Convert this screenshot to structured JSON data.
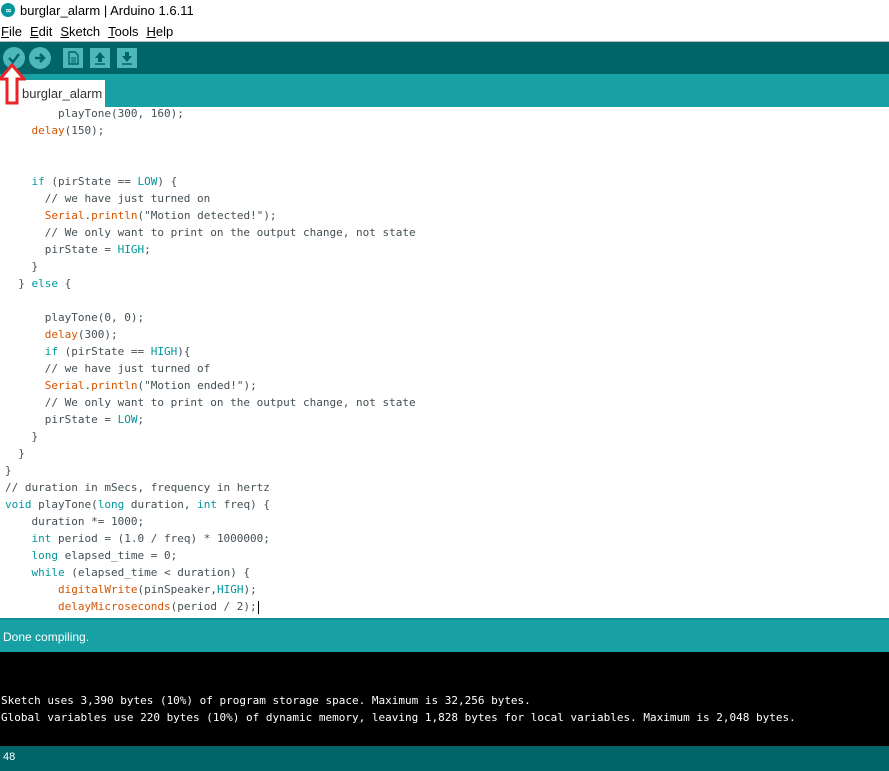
{
  "window": {
    "title": "burglar_alarm | Arduino 1.6.11",
    "logo_icon": "arduino-logo-icon"
  },
  "menu": [
    {
      "first": "F",
      "rest": "ile"
    },
    {
      "first": "E",
      "rest": "dit"
    },
    {
      "first": "S",
      "rest": "ketch"
    },
    {
      "first": "T",
      "rest": "ools"
    },
    {
      "first": "H",
      "rest": "elp"
    }
  ],
  "toolbar": {
    "buttons": [
      "verify-icon",
      "upload-icon",
      "new-icon",
      "open-icon",
      "save-icon"
    ]
  },
  "tab": {
    "label": "burglar_alarm"
  },
  "code": [
    "    playTone(300, 160);",
    "    delay(150);",
    "",
    "",
    "    if (pirState == LOW) {",
    "      // we have just turned on",
    "      Serial.println(\"Motion detected!\");",
    "      // We only want to print on the output change, not state",
    "      pirState = HIGH;",
    "    }",
    "  } else {",
    "",
    "      playTone(0, 0);",
    "      delay(300);",
    "      if (pirState == HIGH){",
    "      // we have just turned of",
    "      Serial.println(\"Motion ended!\");",
    "      // We only want to print on the output change, not state",
    "      pirState = LOW;",
    "    }",
    "  }",
    "}",
    "// duration in mSecs, frequency in hertz",
    "void playTone(long duration, int freq) {",
    "    duration *= 1000;",
    "    int period = (1.0 / freq) * 1000000;",
    "    long elapsed_time = 0;",
    "    while (elapsed_time < duration) {",
    "        digitalWrite(pinSpeaker,HIGH);",
    "        delayMicroseconds(period / 2);"
  ],
  "status": {
    "message": "Done compiling."
  },
  "console": {
    "lines": [
      "Sketch uses 3,390 bytes (10%) of program storage space. Maximum is 32,256 bytes.",
      "Global variables use 220 bytes (10%) of dynamic memory, leaving 1,828 bytes for local variables. Maximum is 2,048 bytes."
    ]
  },
  "footer": {
    "line_number": "48"
  },
  "colors": {
    "toolbar": "#006468",
    "tabbar": "#17a1a5",
    "keyword": "#00979c",
    "function": "#d35400",
    "annotation_arrow": "#e8242a"
  }
}
